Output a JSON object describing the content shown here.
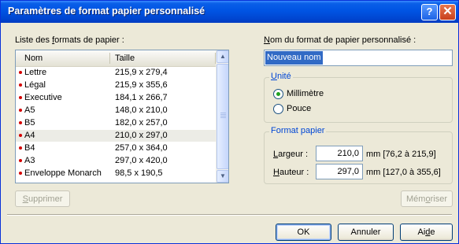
{
  "window": {
    "title": "Paramètres de format papier personnalisé",
    "help_icon": "question-icon",
    "close_icon": "close-icon"
  },
  "list": {
    "label_pre": "Liste des ",
    "label_key": "f",
    "label_post": "ormats de papier :",
    "headers": {
      "name": "Nom",
      "size": "Taille"
    },
    "rows": [
      {
        "name": "Lettre",
        "size": "215,9 x 279,4"
      },
      {
        "name": "Légal",
        "size": "215,9 x 355,6"
      },
      {
        "name": "Executive",
        "size": "184,1 x 266,7"
      },
      {
        "name": "A5",
        "size": "148,0 x 210,0"
      },
      {
        "name": "B5",
        "size": "182,0 x 257,0"
      },
      {
        "name": "A4",
        "size": "210,0 x 297,0",
        "selected": true
      },
      {
        "name": "B4",
        "size": "257,0 x 364,0"
      },
      {
        "name": "A3",
        "size": "297,0 x 420,0"
      },
      {
        "name": "Enveloppe Monarch",
        "size": "98,5 x 190,5"
      }
    ],
    "bullet_color": "#d40000"
  },
  "delete_button": {
    "key": "S",
    "rest": "upprimer"
  },
  "name_field": {
    "label_key": "N",
    "label_rest": "om du format de papier personnalisé :",
    "value": "Nouveau nom"
  },
  "unit_group": {
    "legend_key": "U",
    "legend_rest": "nité",
    "options": [
      {
        "label": "Millimètre",
        "checked": true
      },
      {
        "label": "Pouce",
        "checked": false
      }
    ]
  },
  "format_group": {
    "legend": "Format papier",
    "width": {
      "label_key": "L",
      "label_rest": "argeur :",
      "value": "210,0",
      "range": "mm [76,2 à 215,9]"
    },
    "height": {
      "label_key": "H",
      "label_rest": "auteur :",
      "value": "297,0",
      "range": "mm [127,0 à 355,6]"
    }
  },
  "save_button": {
    "pre": "Mém",
    "key": "o",
    "post": "riser"
  },
  "ok_button": "OK",
  "cancel_button": "Annuler",
  "help_button": {
    "pre": "Ai",
    "key": "d",
    "post": "e"
  }
}
